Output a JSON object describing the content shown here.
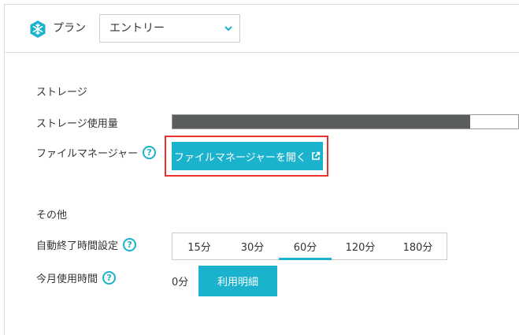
{
  "header": {
    "plan_icon": "snowflake-icon",
    "plan_label": "プラン",
    "plan_select_value": "エントリー"
  },
  "storage": {
    "section_title": "ストレージ",
    "usage_label": "ストレージ使用量",
    "usage_fraction": 0.86,
    "fm_label": "ファイルマネージャー",
    "fm_button_label": "ファイルマネージャーを開く",
    "fm_button_icon": "external-link-icon"
  },
  "other": {
    "section_title": "その他",
    "auto_shutdown_label": "自動終了時間設定",
    "auto_shutdown_options": [
      "15分",
      "30分",
      "60分",
      "120分",
      "180分"
    ],
    "auto_shutdown_selected": "60分",
    "monthly_usage_label": "今月使用時間",
    "monthly_usage_value": "0分",
    "detail_button_label": "利用明細"
  },
  "help_icon_text": "?",
  "colors": {
    "accent": "#1ab2cc",
    "highlight": "#e8322c",
    "bar_fill": "#5a5d5e"
  }
}
